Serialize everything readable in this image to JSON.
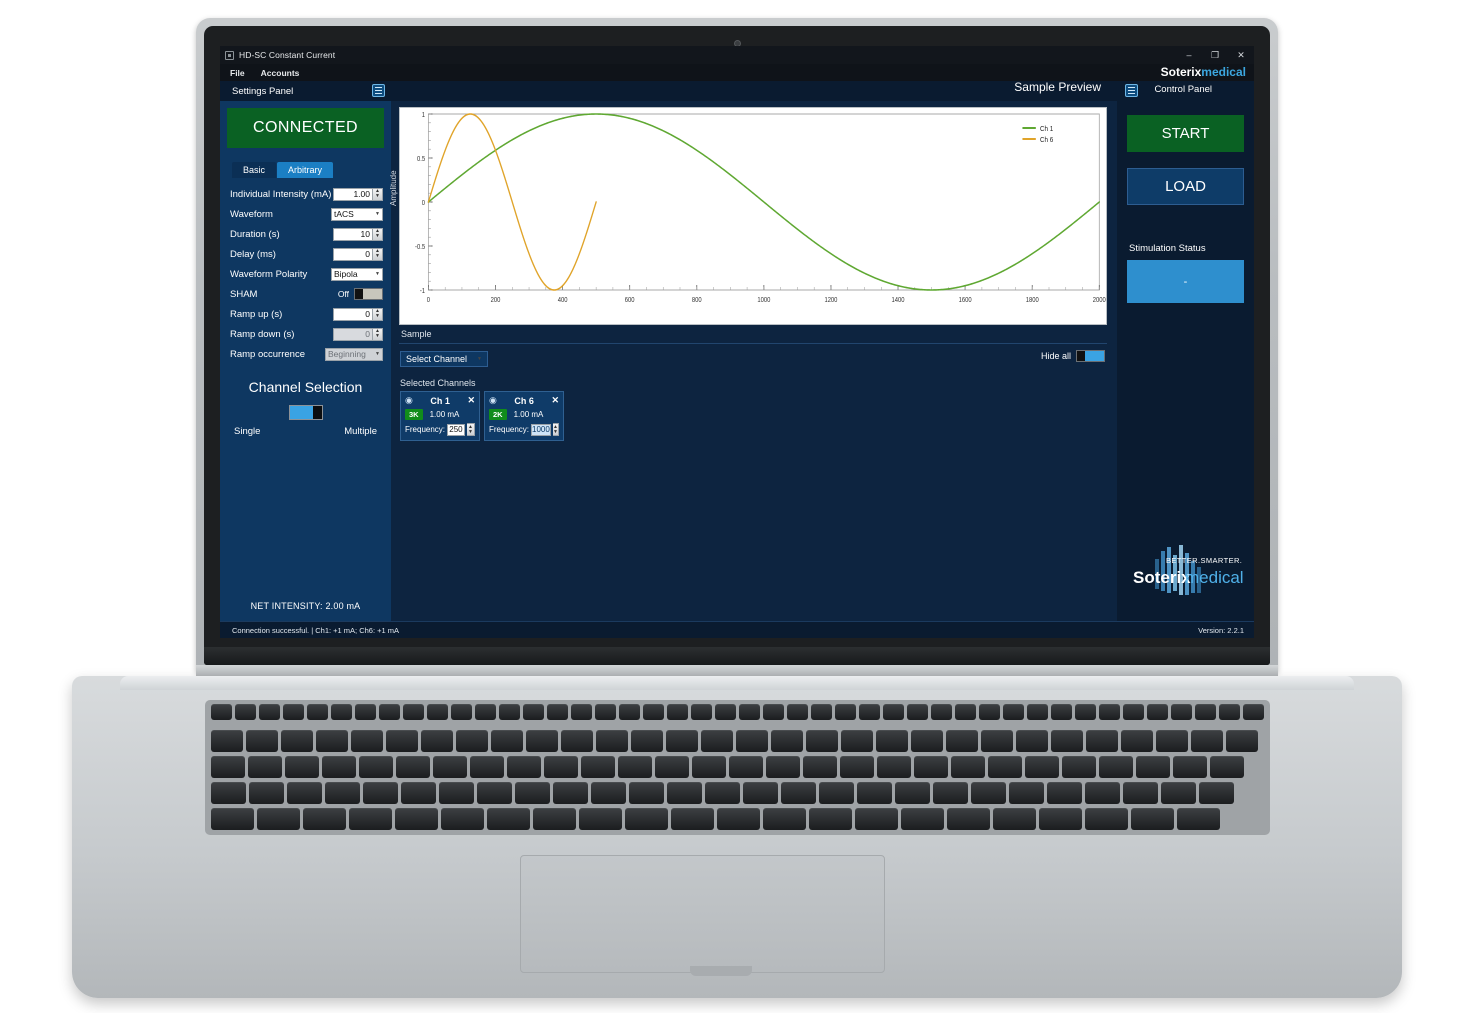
{
  "window": {
    "title": "HD-SC Constant Current",
    "minimize": "–",
    "maximize": "❐",
    "close": "✕"
  },
  "menubar": {
    "items": [
      "File",
      "Accounts"
    ],
    "brand_1": "Soterix",
    "brand_2": "medical"
  },
  "header": {
    "settings_panel_label": "Settings Panel",
    "control_panel_label": "Control Panel"
  },
  "settings": {
    "connection_status": "CONNECTED",
    "tabs": [
      {
        "label": "Basic",
        "active": false
      },
      {
        "label": "Arbitrary",
        "active": true
      }
    ],
    "fields": [
      {
        "label": "Individual Intensity (mA)",
        "value": "1.00",
        "type": "spinner"
      },
      {
        "label": "Waveform",
        "value": "tACS",
        "type": "combo"
      },
      {
        "label": "Duration (s)",
        "value": "10",
        "type": "spinner"
      },
      {
        "label": "Delay (ms)",
        "value": "0",
        "type": "spinner"
      },
      {
        "label": "Waveform Polarity",
        "value": "Bipola",
        "type": "combo"
      },
      {
        "label": "SHAM",
        "value": "Off",
        "type": "toggle"
      },
      {
        "label": "Ramp up (s)",
        "value": "0",
        "type": "spinner"
      },
      {
        "label": "Ramp down (s)",
        "value": "0",
        "type": "spinner-dim"
      },
      {
        "label": "Ramp occurrence",
        "value": "Beginning",
        "type": "combo-dim"
      }
    ],
    "channel_selection_title": "Channel Selection",
    "channel_mode_left": "Single",
    "channel_mode_right": "Multiple",
    "channel_mode_value": "Multiple",
    "net_intensity": "NET INTENSITY: 2.00 mA"
  },
  "main": {
    "preview_title": "Sample Preview",
    "sample_label": "Sample",
    "select_channel_label": "Select Channel",
    "select_channel_caret": "⌄",
    "hide_all_label": "Hide all",
    "hide_all_value": "on",
    "selected_channels_label": "Selected Channels",
    "channels": [
      {
        "name": "Ch 1",
        "eye_icon": "◉",
        "close_icon": "✕",
        "impedance_badge": "3K",
        "intensity": "1.00 mA",
        "frequency_label": "Frequency:",
        "frequency": "250",
        "frequency_selected": false
      },
      {
        "name": "Ch 6",
        "eye_icon": "◉",
        "close_icon": "✕",
        "impedance_badge": "2K",
        "intensity": "1.00 mA",
        "frequency_label": "Frequency:",
        "frequency": "1000",
        "frequency_selected": true
      }
    ]
  },
  "control": {
    "start_label": "START",
    "load_label": "LOAD",
    "stimulation_status_label": "Stimulation Status",
    "stimulation_status_value": "-",
    "logo_tagline": "BETTER. SMARTER.",
    "logo_1": "Soterix",
    "logo_2": "medical"
  },
  "statusbar": {
    "message": "Connection successful. | Ch1: +1 mA; Ch6: +1 mA",
    "version": "Version: 2.2.1"
  },
  "colors": {
    "connected_green": "#0a6123",
    "accent_blue": "#1b7fc4",
    "panel_blue": "#0e3761",
    "background_blue": "#0d2440",
    "series_ch1": "#5fa832",
    "series_ch6": "#e0a42a"
  },
  "chart_data": {
    "type": "line",
    "title": "Sample Preview",
    "xlabel": "Sample",
    "ylabel": "Amplitude",
    "xlim": [
      0,
      2000
    ],
    "ylim": [
      -1,
      1
    ],
    "xticks": [
      0,
      200,
      400,
      600,
      800,
      1000,
      1200,
      1400,
      1600,
      1800,
      2000
    ],
    "yticks": [
      -1,
      -0.5,
      0,
      0.5,
      1
    ],
    "grid": false,
    "legend_position": "top-right",
    "series": [
      {
        "name": "Ch 1",
        "color": "#5fa832",
        "waveform": "sine",
        "amplitude": 1,
        "period_samples": 2000,
        "x_start": 0,
        "x_end": 2000,
        "points": [
          [
            0,
            0
          ],
          [
            100,
            0.309
          ],
          [
            200,
            0.588
          ],
          [
            300,
            0.809
          ],
          [
            400,
            0.951
          ],
          [
            500,
            1.0
          ],
          [
            600,
            0.951
          ],
          [
            700,
            0.809
          ],
          [
            800,
            0.588
          ],
          [
            900,
            0.309
          ],
          [
            1000,
            0
          ],
          [
            1100,
            -0.309
          ],
          [
            1200,
            -0.588
          ],
          [
            1300,
            -0.809
          ],
          [
            1400,
            -0.951
          ],
          [
            1500,
            -1.0
          ],
          [
            1600,
            -0.951
          ],
          [
            1700,
            -0.809
          ],
          [
            1800,
            -0.588
          ],
          [
            1900,
            -0.309
          ],
          [
            2000,
            0
          ]
        ]
      },
      {
        "name": "Ch 6",
        "color": "#e0a42a",
        "waveform": "sine",
        "amplitude": 1,
        "period_samples": 500,
        "x_start": 0,
        "x_end": 500,
        "points": [
          [
            0,
            0
          ],
          [
            25,
            0.309
          ],
          [
            50,
            0.588
          ],
          [
            75,
            0.809
          ],
          [
            100,
            0.951
          ],
          [
            125,
            1.0
          ],
          [
            150,
            0.951
          ],
          [
            175,
            0.809
          ],
          [
            200,
            0.588
          ],
          [
            225,
            0.309
          ],
          [
            250,
            0
          ],
          [
            275,
            -0.309
          ],
          [
            300,
            -0.588
          ],
          [
            325,
            -0.809
          ],
          [
            350,
            -0.951
          ],
          [
            375,
            -1.0
          ],
          [
            400,
            -0.951
          ],
          [
            425,
            -0.809
          ],
          [
            450,
            -0.588
          ],
          [
            475,
            -0.309
          ],
          [
            500,
            -0.05
          ]
        ]
      }
    ]
  }
}
